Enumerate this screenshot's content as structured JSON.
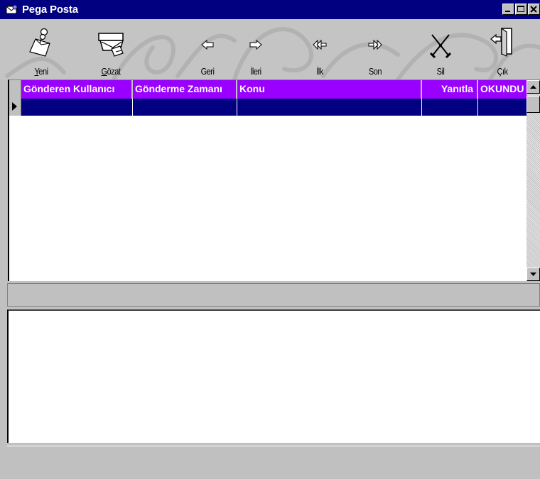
{
  "window": {
    "title": "Pega Posta"
  },
  "toolbar": {
    "buttons": [
      {
        "label": "Yeni",
        "accel": "Y",
        "icon": "new-mail-icon"
      },
      {
        "label": "Gözat",
        "accel": "G",
        "icon": "browse-mail-icon"
      },
      {
        "label": "Geri",
        "icon": "arrow-left-icon"
      },
      {
        "label": "İleri",
        "icon": "arrow-right-icon"
      },
      {
        "label": "İlk",
        "icon": "first-record-icon"
      },
      {
        "label": "Son",
        "icon": "last-record-icon"
      },
      {
        "label": "Sil",
        "icon": "delete-icon"
      },
      {
        "label": "Çık",
        "icon": "exit-door-icon"
      }
    ]
  },
  "grid": {
    "columns": [
      "Gönderen Kullanıcı",
      "Gönderme Zamanı",
      "Konu",
      "Yanıtla",
      "OKUNDU"
    ],
    "header_color": "#9900ff",
    "selected_row_color": "#000080"
  }
}
